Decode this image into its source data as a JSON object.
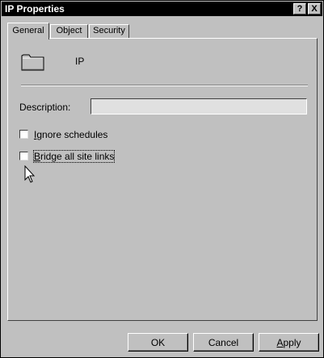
{
  "window": {
    "title": "IP Properties",
    "help_glyph": "?",
    "close_glyph": "X"
  },
  "tabs": [
    {
      "label": "General",
      "active": true
    },
    {
      "label": "Object",
      "active": false
    },
    {
      "label": "Security",
      "active": false
    }
  ],
  "general": {
    "icon": "folder-icon",
    "object_name": "IP",
    "description_label": "Description:",
    "description_value": "",
    "checkboxes": [
      {
        "accel": "I",
        "rest": "gnore schedules",
        "checked": false
      },
      {
        "accel": "B",
        "rest": "ridge all site links",
        "checked": false
      }
    ]
  },
  "buttons": {
    "ok": "OK",
    "cancel": "Cancel",
    "apply_accel": "A",
    "apply_rest": "pply"
  },
  "colors": {
    "title_bar": "#000000",
    "face": "#c0c0c0"
  }
}
